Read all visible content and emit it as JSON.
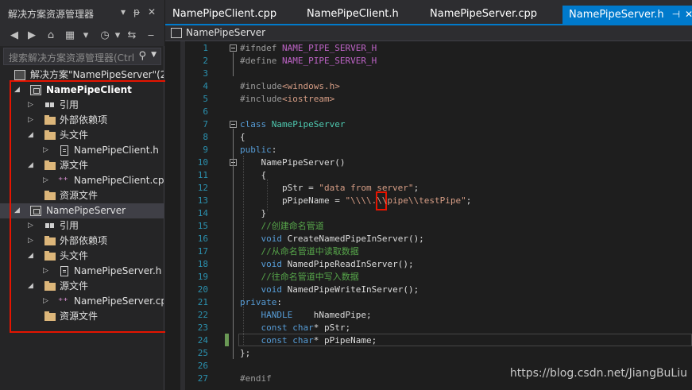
{
  "solution_explorer": {
    "title": "解决方案资源管理器",
    "title_buttons": [
      "▾",
      "ᵽ",
      "✕"
    ],
    "search_placeholder": "搜索解决方案资源管理器(Ctrl",
    "solution_label": "解决方案\"NamePipeServer\"(2",
    "tree": [
      {
        "label": "NamePipeClient",
        "bold": true,
        "expander": "◢",
        "icon": "project-icon"
      },
      {
        "label": "引用",
        "expander": "▷",
        "icon": "reference-icon"
      },
      {
        "label": "外部依赖项",
        "expander": "▷",
        "icon": "external-deps-icon"
      },
      {
        "label": "头文件",
        "expander": "◢",
        "icon": "folder-icon"
      },
      {
        "label": "NamePipeClient.h",
        "expander": "▷",
        "icon": "header-file-icon"
      },
      {
        "label": "源文件",
        "expander": "◢",
        "icon": "folder-icon"
      },
      {
        "label": "NamePipeClient.cp",
        "expander": "▷",
        "icon": "cpp-file-icon"
      },
      {
        "label": "资源文件",
        "expander": "",
        "icon": "folder-icon"
      },
      {
        "label": "NamePipeServer",
        "bold": false,
        "expander": "◢",
        "icon": "project-icon",
        "selected": true
      },
      {
        "label": "引用",
        "expander": "▷",
        "icon": "reference-icon"
      },
      {
        "label": "外部依赖项",
        "expander": "▷",
        "icon": "external-deps-icon"
      },
      {
        "label": "头文件",
        "expander": "◢",
        "icon": "folder-icon"
      },
      {
        "label": "NamePipeServer.h",
        "expander": "▷",
        "icon": "header-file-icon"
      },
      {
        "label": "源文件",
        "expander": "◢",
        "icon": "folder-icon"
      },
      {
        "label": "NamePipeServer.cp",
        "expander": "▷",
        "icon": "cpp-file-icon"
      },
      {
        "label": "资源文件",
        "expander": "",
        "icon": "folder-icon"
      }
    ]
  },
  "tabs": [
    {
      "label": "NamePipeClient.cpp",
      "active": false
    },
    {
      "label": "NamePipeClient.h",
      "active": false
    },
    {
      "label": "NamePipeServer.cpp",
      "active": false
    },
    {
      "label": "NamePipeServer.h",
      "active": true
    }
  ],
  "tab_pin": "⊣",
  "tab_close": "✕",
  "nav_bar": {
    "scope": "NamePipeServer"
  },
  "editor": {
    "line_numbers": [
      "1",
      "2",
      "3",
      "4",
      "5",
      "6",
      "7",
      "8",
      "9",
      "10",
      "11",
      "12",
      "13",
      "14",
      "15",
      "16",
      "17",
      "18",
      "19",
      "20",
      "21",
      "22",
      "23",
      "24",
      "25",
      "26",
      "27"
    ],
    "lines": [
      "#ifndef NAME_PIPE_SERVER_H",
      "#define NAME_PIPE_SERVER_H",
      "",
      "#include<windows.h>",
      "#include<iostream>",
      "",
      "class NamePipeServer",
      "{",
      "public:",
      "    NamePipeServer()",
      "    {",
      "        pStr = \"data from server\";",
      "        pPipeName = \"\\\\\\\\.\\\\pipe\\\\testPipe\";",
      "    }",
      "    //创建命名管道",
      "    void CreateNamedPipeInServer();",
      "    //从命名管道中读取数据",
      "    void NamedPipeReadInServer();",
      "    //往命名管道中写入数据",
      "    void NamedPipeWriteInServer();",
      "private:",
      "    HANDLE    hNamedPipe;",
      "    const char* pStr;",
      "    const char* pPipeName;",
      "};",
      "",
      "#endif"
    ]
  },
  "watermark": "https://blog.csdn.net/JiangBuLiu",
  "colors": {
    "accent": "#007acc",
    "highlight_box": "#e51400",
    "keyword": "#569cd6",
    "macro": "#bd63c5",
    "string": "#d69d85",
    "comment": "#57a64a",
    "type": "#4ec9b0"
  }
}
